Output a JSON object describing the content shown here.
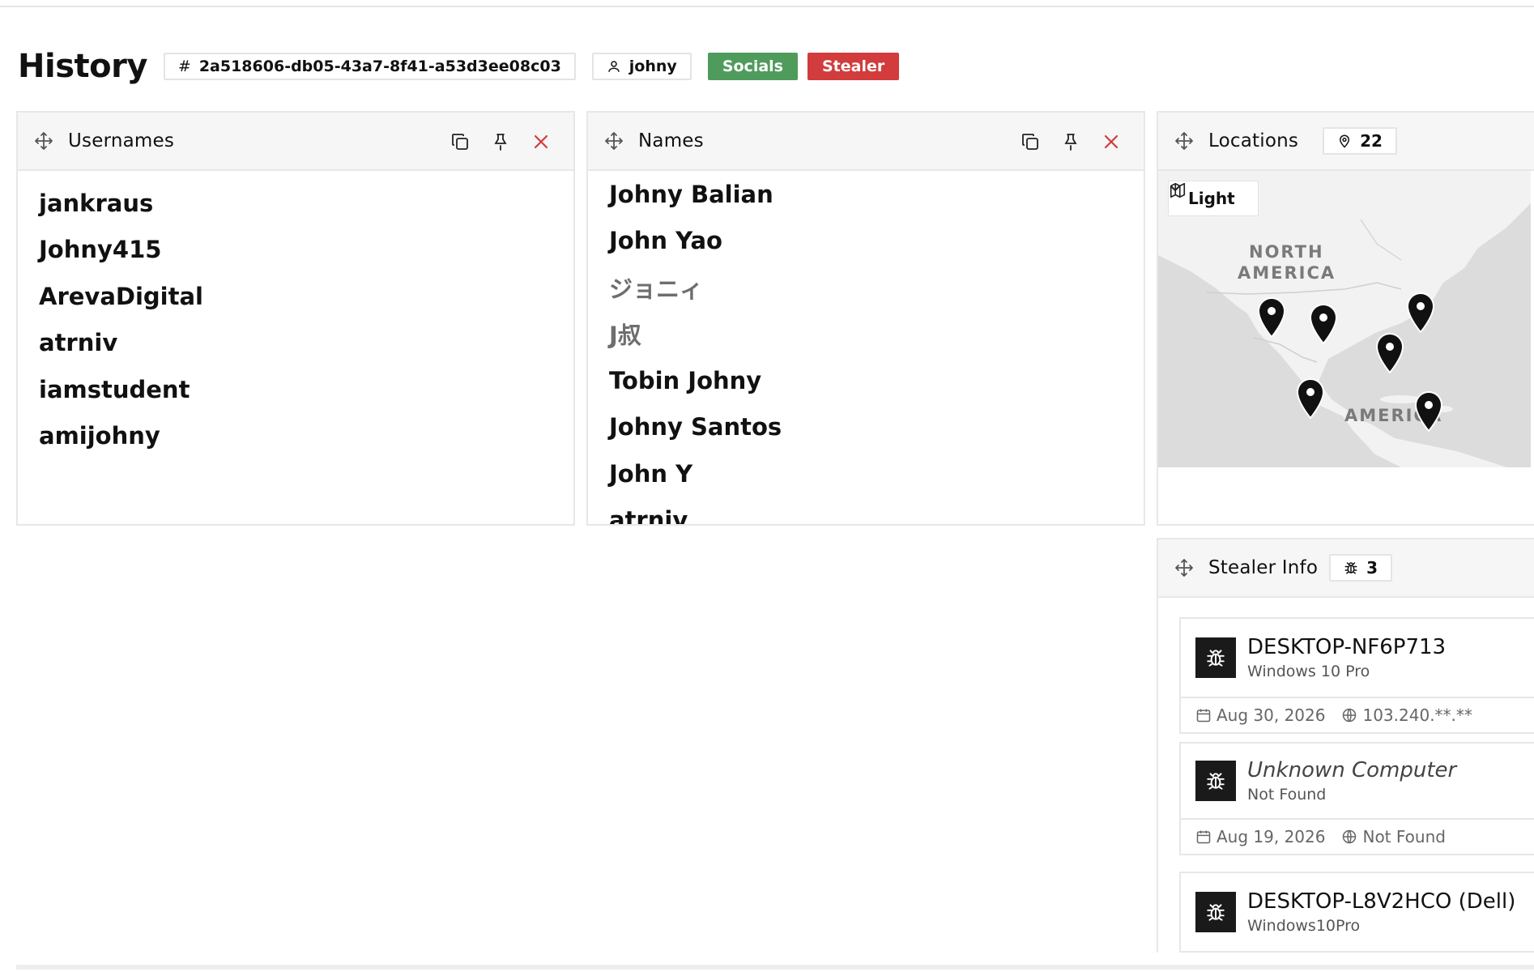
{
  "page": {
    "title": "History"
  },
  "header": {
    "id_prefix": "#",
    "record_id": "2a518606-db05-43a7-8f41-a53d3ee08c03",
    "user": "johny",
    "tags": [
      {
        "label": "Socials",
        "color": "#4f9b5b"
      },
      {
        "label": "Stealer",
        "color": "#d23c3c"
      }
    ]
  },
  "usernames": {
    "title": "Usernames",
    "items": [
      "jankraus",
      "Johny415",
      "ArevaDigital",
      "atrniv",
      "iamstudent",
      "amijohny"
    ]
  },
  "names": {
    "title": "Names",
    "items": [
      "Johny Balian",
      "John Yao",
      "ジョニィ",
      "J叔",
      "Tobin Johny",
      "Johny Santos",
      "John Y",
      "atrniv"
    ]
  },
  "locations": {
    "title": "Locations",
    "count": "22",
    "map_style": "Light",
    "labels": {
      "north_line1": "NORTH",
      "north_line2": "AMERICA",
      "south": "AMERICA"
    }
  },
  "stealer_info": {
    "title": "Stealer Info",
    "count": "3",
    "cards": [
      {
        "name": "DESKTOP-NF6P713",
        "os": "Windows 10 Pro",
        "date": "Aug 30, 2026",
        "ip": "103.240.**.**",
        "unknown": false
      },
      {
        "name": "Unknown Computer",
        "os": "Not Found",
        "date": "Aug 19, 2026",
        "ip": "Not Found",
        "unknown": true
      },
      {
        "name": "DESKTOP-L8V2HCO (Dell)",
        "os": "Windows10Pro",
        "date": "",
        "ip": "",
        "unknown": false
      }
    ]
  },
  "colors": {
    "accent_red": "#d23c3c",
    "accent_green": "#4f9b5b",
    "panel_header_bg": "#f6f6f6",
    "border": "#e7e7e7"
  }
}
